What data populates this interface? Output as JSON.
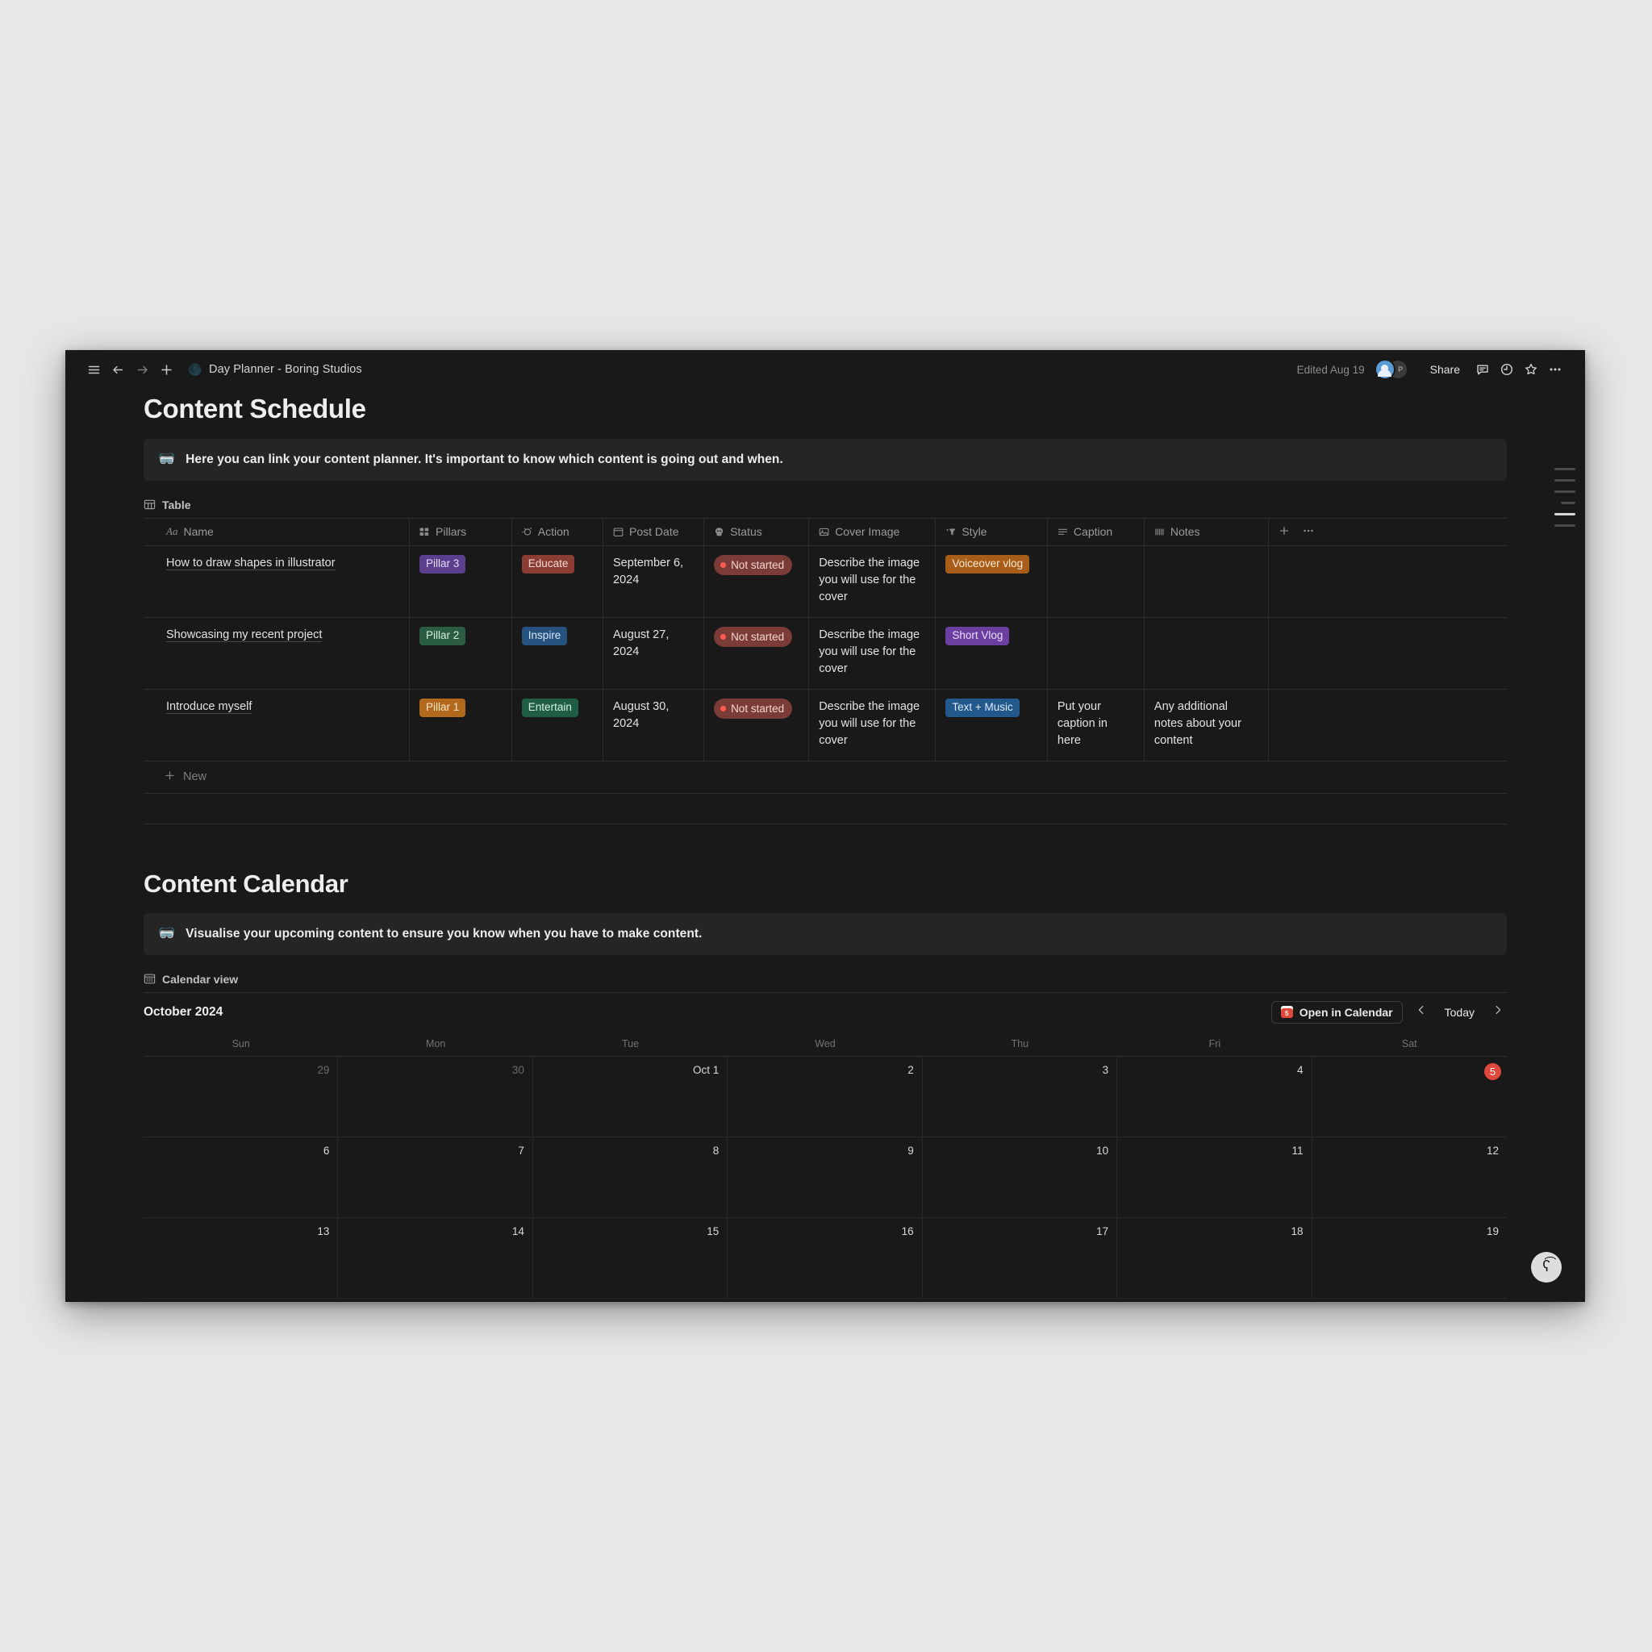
{
  "topbar": {
    "menu_icon": "hamburger-icon",
    "back_icon": "arrow-left-icon",
    "forward_icon": "arrow-right-icon",
    "new_icon": "plus-icon",
    "breadcrumb_emoji": "🌑",
    "breadcrumb_title": "Day Planner - Boring Studios",
    "edited": "Edited Aug 19",
    "avatar_initial": "P",
    "share_label": "Share",
    "comment_icon": "comment-icon",
    "history_icon": "clock-icon",
    "favorite_icon": "star-icon",
    "more_icon": "ellipsis-icon"
  },
  "schedule": {
    "title": "Content Schedule",
    "callout_icon": "🥽",
    "callout_text": "Here you can link your content planner. It's important to know which content is going out and when.",
    "view_label": "Table",
    "view_icon": "table-icon",
    "new_row_label": "New",
    "columns": [
      {
        "label": "Name",
        "icon": "Aa",
        "key": "name"
      },
      {
        "label": "Pillars",
        "icon": "multi-select-icon",
        "key": "pillars"
      },
      {
        "label": "Action",
        "icon": "select-icon",
        "key": "action"
      },
      {
        "label": "Post Date",
        "icon": "calendar-icon",
        "key": "post_date"
      },
      {
        "label": "Status",
        "icon": "status-icon",
        "key": "status"
      },
      {
        "label": "Cover Image",
        "icon": "image-icon",
        "key": "cover_image"
      },
      {
        "label": "Style",
        "icon": "select-icon",
        "key": "style"
      },
      {
        "label": "Caption",
        "icon": "text-icon",
        "key": "caption"
      },
      {
        "label": "Notes",
        "icon": "text-lines-icon",
        "key": "notes"
      }
    ],
    "rows": [
      {
        "name": "How to draw shapes in illustrator",
        "pillars": "Pillar 3",
        "pillars_bg": "#5b3f8e",
        "pillars_fg": "#e4d9f7",
        "action": "Educate",
        "action_bg": "#8b3c33",
        "action_fg": "#f4d9d4",
        "post_date": "September 6, 2024",
        "status": "Not started",
        "status_bg": "#7b3b36",
        "status_fg": "#f2d6d1",
        "cover_image": "Describe the image you will use for the cover",
        "style": "Voiceover vlog",
        "style_bg": "#a85d18",
        "style_fg": "#f8e7d4",
        "caption": "",
        "notes": ""
      },
      {
        "name": "Showcasing my recent project",
        "pillars": "Pillar 2",
        "pillars_bg": "#2b5d44",
        "pillars_fg": "#d2efdf",
        "action": "Inspire",
        "action_bg": "#25527e",
        "action_fg": "#d7e8f8",
        "post_date": "August 27, 2024",
        "status": "Not started",
        "status_bg": "#7b3b36",
        "status_fg": "#f2d6d1",
        "cover_image": "Describe the image you will use for the cover",
        "style": "Short Vlog",
        "style_bg": "#6a3fa0",
        "style_fg": "#eadcfb",
        "caption": "",
        "notes": ""
      },
      {
        "name": "Introduce myself",
        "pillars": "Pillar 1",
        "pillars_bg": "#b2691c",
        "pillars_fg": "#f9e4cc",
        "action": "Entertain",
        "action_bg": "#1f5e45",
        "action_fg": "#d6f1e3",
        "post_date": "August 30, 2024",
        "status": "Not started",
        "status_bg": "#7b3b36",
        "status_fg": "#f2d6d1",
        "cover_image": "Describe the image you will use for the cover",
        "style": "Text + Music",
        "style_bg": "#22588c",
        "style_fg": "#dceaf9",
        "caption": "Put your caption in here",
        "notes": "Any additional notes about your content"
      }
    ]
  },
  "calendar": {
    "title": "Content Calendar",
    "callout_icon": "🥽",
    "callout_text": "Visualise your upcoming content to ensure you know when you have to make content.",
    "view_label": "Calendar view",
    "view_icon": "calendar-view-icon",
    "month": "October 2024",
    "open_label": "Open in Calendar",
    "open_icon": "calendar-badge-icon",
    "today_label": "Today",
    "prev_icon": "chevron-left-icon",
    "next_icon": "chevron-right-icon",
    "weekdays": [
      "Sun",
      "Mon",
      "Tue",
      "Wed",
      "Thu",
      "Fri",
      "Sat"
    ],
    "today_accent": "#e0483b",
    "cells": [
      {
        "label": "29",
        "muted": true
      },
      {
        "label": "30",
        "muted": true
      },
      {
        "label": "Oct 1",
        "muted": false
      },
      {
        "label": "2",
        "muted": false
      },
      {
        "label": "3",
        "muted": false
      },
      {
        "label": "4",
        "muted": false
      },
      {
        "label": "5",
        "muted": false,
        "today": true
      },
      {
        "label": "6",
        "muted": false
      },
      {
        "label": "7",
        "muted": false
      },
      {
        "label": "8",
        "muted": false
      },
      {
        "label": "9",
        "muted": false
      },
      {
        "label": "10",
        "muted": false
      },
      {
        "label": "11",
        "muted": false
      },
      {
        "label": "12",
        "muted": false
      },
      {
        "label": "13",
        "muted": false
      },
      {
        "label": "14",
        "muted": false
      },
      {
        "label": "15",
        "muted": false
      },
      {
        "label": "16",
        "muted": false
      },
      {
        "label": "17",
        "muted": false
      },
      {
        "label": "18",
        "muted": false
      },
      {
        "label": "19",
        "muted": false
      }
    ]
  },
  "fab": {
    "glyph": "ʕ͡"
  }
}
